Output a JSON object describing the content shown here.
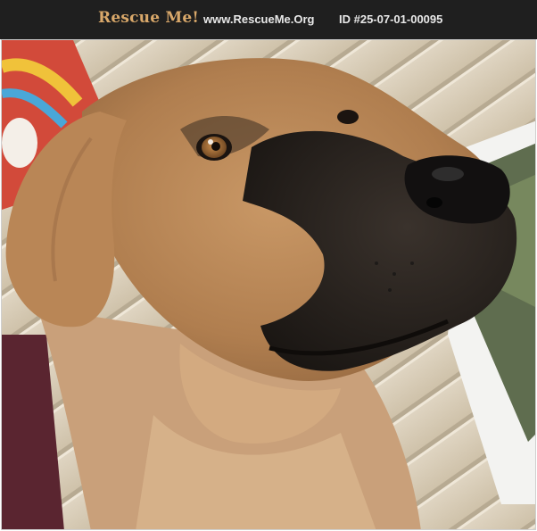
{
  "header": {
    "brand": "Rescue Me!",
    "site": "www.RescueMe.Org",
    "pet_id": "ID #25-07-01-00095"
  },
  "photo": {
    "subject": "dog-photo",
    "colors": {
      "siding": "#d8cdb8",
      "fur": "#b8885a",
      "muzzle": "#2a2521",
      "header_bg": "#1f1f1f",
      "brand": "#d9a86a"
    }
  }
}
